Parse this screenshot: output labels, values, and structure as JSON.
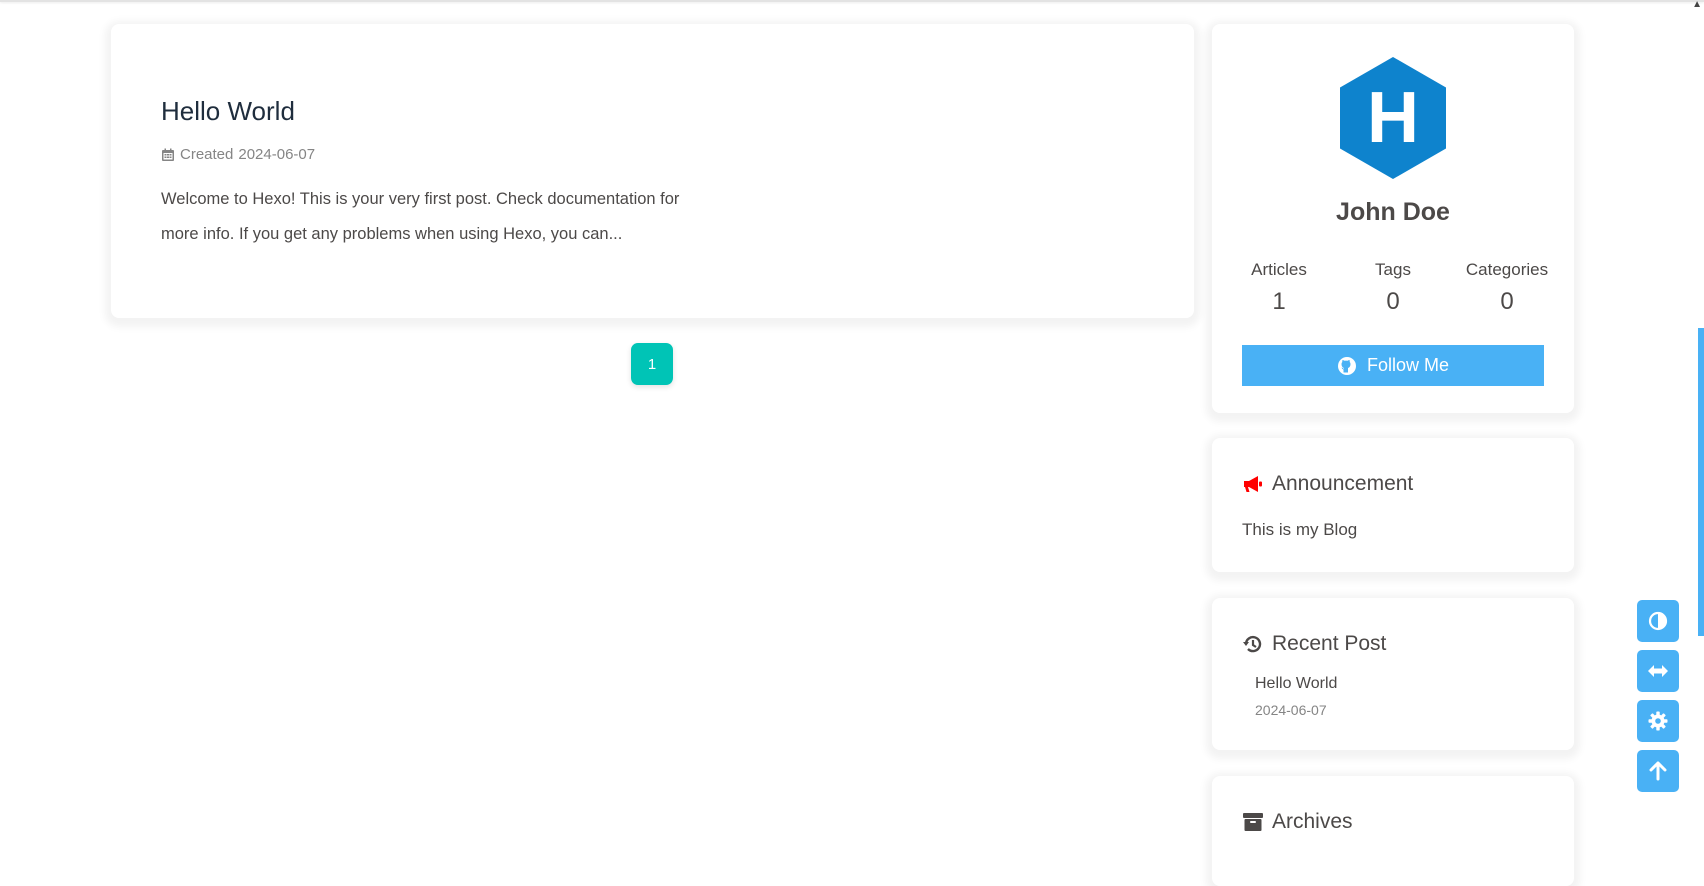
{
  "post": {
    "title": "Hello World",
    "created_label": "Created",
    "created_date": "2024-06-07",
    "excerpt": "Welcome to Hexo! This is your very first post. Check documentation for more info. If you get any problems when using Hexo, you can..."
  },
  "pagination": {
    "current": "1"
  },
  "author": {
    "avatar_letter": "H",
    "name": "John Doe",
    "stats": [
      {
        "label": "Articles",
        "value": "1"
      },
      {
        "label": "Tags",
        "value": "0"
      },
      {
        "label": "Categories",
        "value": "0"
      }
    ],
    "follow_label": "Follow Me"
  },
  "announcement": {
    "title": "Announcement",
    "text": "This is my Blog"
  },
  "recent": {
    "title": "Recent Post",
    "items": [
      {
        "title": "Hello World",
        "date": "2024-06-07"
      }
    ]
  },
  "archives": {
    "title": "Archives"
  },
  "side_buttons": [
    "dark-mode-icon",
    "expand-width-icon",
    "gear-icon",
    "arrow-up-icon"
  ],
  "colors": {
    "accent": "#49b1f5",
    "pager": "#00c4b6",
    "avatar": "#0e83cd",
    "announcement_icon": "#ff0000"
  }
}
